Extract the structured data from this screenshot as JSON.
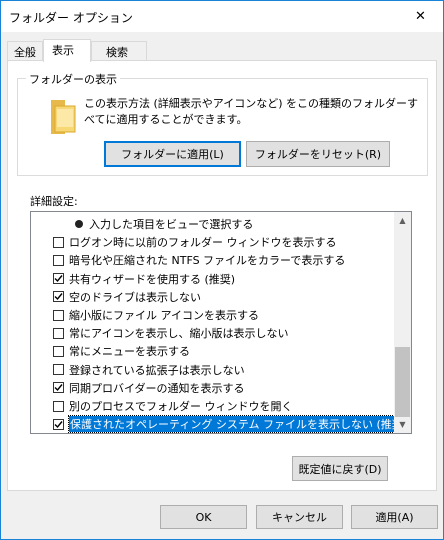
{
  "window": {
    "title": "フォルダー オプション",
    "close_glyph": "✕"
  },
  "tabs": [
    {
      "label": "全般",
      "active": false
    },
    {
      "label": "表示",
      "active": true
    },
    {
      "label": "検索",
      "active": false
    }
  ],
  "folder_views": {
    "legend": "フォルダーの表示",
    "description": "この表示方法 (詳細表示やアイコンなど) をこの種類のフォルダーすべてに適用することができます。",
    "apply_label": "フォルダーに適用(L)",
    "reset_label": "フォルダーをリセット(R)"
  },
  "advanced": {
    "label": "詳細設定:",
    "items": [
      {
        "type": "radio",
        "checked": true,
        "label": "入力した項目をビューで選択する"
      },
      {
        "type": "checkbox",
        "checked": false,
        "label": "ログオン時に以前のフォルダー ウィンドウを表示する"
      },
      {
        "type": "checkbox",
        "checked": false,
        "label": "暗号化や圧縮された NTFS ファイルをカラーで表示する"
      },
      {
        "type": "checkbox",
        "checked": true,
        "label": "共有ウィザードを使用する (推奨)"
      },
      {
        "type": "checkbox",
        "checked": true,
        "label": "空のドライブは表示しない"
      },
      {
        "type": "checkbox",
        "checked": false,
        "label": "縮小版にファイル アイコンを表示する"
      },
      {
        "type": "checkbox",
        "checked": false,
        "label": "常にアイコンを表示し、縮小版は表示しない"
      },
      {
        "type": "checkbox",
        "checked": false,
        "label": "常にメニューを表示する"
      },
      {
        "type": "checkbox",
        "checked": false,
        "label": "登録されている拡張子は表示しない"
      },
      {
        "type": "checkbox",
        "checked": true,
        "label": "同期プロバイダーの通知を表示する"
      },
      {
        "type": "checkbox",
        "checked": false,
        "label": "別のプロセスでフォルダー ウィンドウを開く"
      },
      {
        "type": "checkbox",
        "checked": true,
        "selected": true,
        "label": "保護されたオペレーティング システム ファイルを表示しない (推奨)"
      }
    ],
    "restore_label": "既定値に戻す(D)"
  },
  "footer": {
    "ok": "OK",
    "cancel": "キャンセル",
    "apply": "適用(A)"
  },
  "colors": {
    "accent": "#0078d7",
    "window_border": "#1883d7",
    "folder": "#f8d775"
  }
}
